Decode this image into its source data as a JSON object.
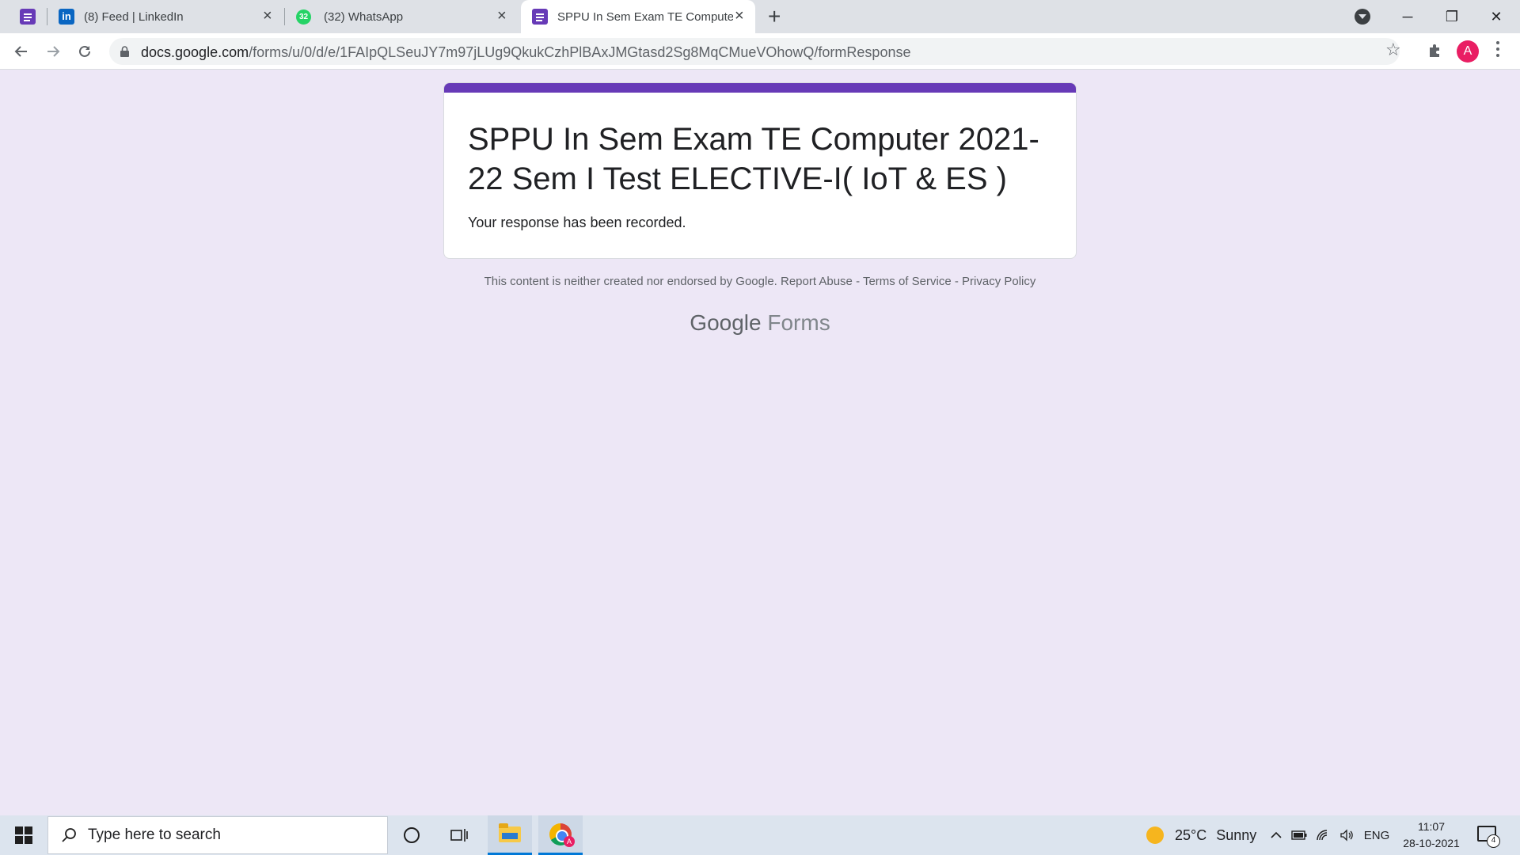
{
  "browser": {
    "tabs": [
      {
        "label": "",
        "icon": "google-forms-icon"
      },
      {
        "label": "(8) Feed | LinkedIn",
        "icon": "linkedin-icon",
        "badge": "in"
      },
      {
        "label": "(32) WhatsApp",
        "icon": "whatsapp-icon",
        "badge": "32"
      },
      {
        "label": "SPPU In Sem Exam TE Computer",
        "icon": "google-forms-icon",
        "active": true
      }
    ],
    "new_tab": "+",
    "window_controls": {
      "minimize": "─",
      "restore": "❐",
      "close": "✕"
    },
    "url_host": "docs.google.com",
    "url_path": "/forms/u/0/d/e/1FAIpQLSeuJY7m97jLUg9QkukCzhPlBAxJMGtasd2Sg8MqCMueVOhowQ/formResponse",
    "profile_initial": "A"
  },
  "form": {
    "accent_color": "#673ab7",
    "title": "SPPU In Sem Exam TE Computer 2021-22 Sem I Test ELECTIVE-I( IoT & ES )",
    "message": "Your response has been recorded."
  },
  "footer": {
    "disclaimer": "This content is neither created nor endorsed by Google.",
    "report_abuse": "Report Abuse",
    "sep1": " - ",
    "terms": "Terms of Service",
    "sep2": " - ",
    "privacy": "Privacy Policy",
    "brand_google": "Google",
    "brand_forms": "Forms"
  },
  "taskbar": {
    "search_placeholder": "Type here to search",
    "chrome_badge": "A",
    "weather_temp": "25°C",
    "weather_desc": "Sunny",
    "language": "ENG",
    "time": "11:07",
    "date": "28-10-2021",
    "notification_count": "4"
  }
}
